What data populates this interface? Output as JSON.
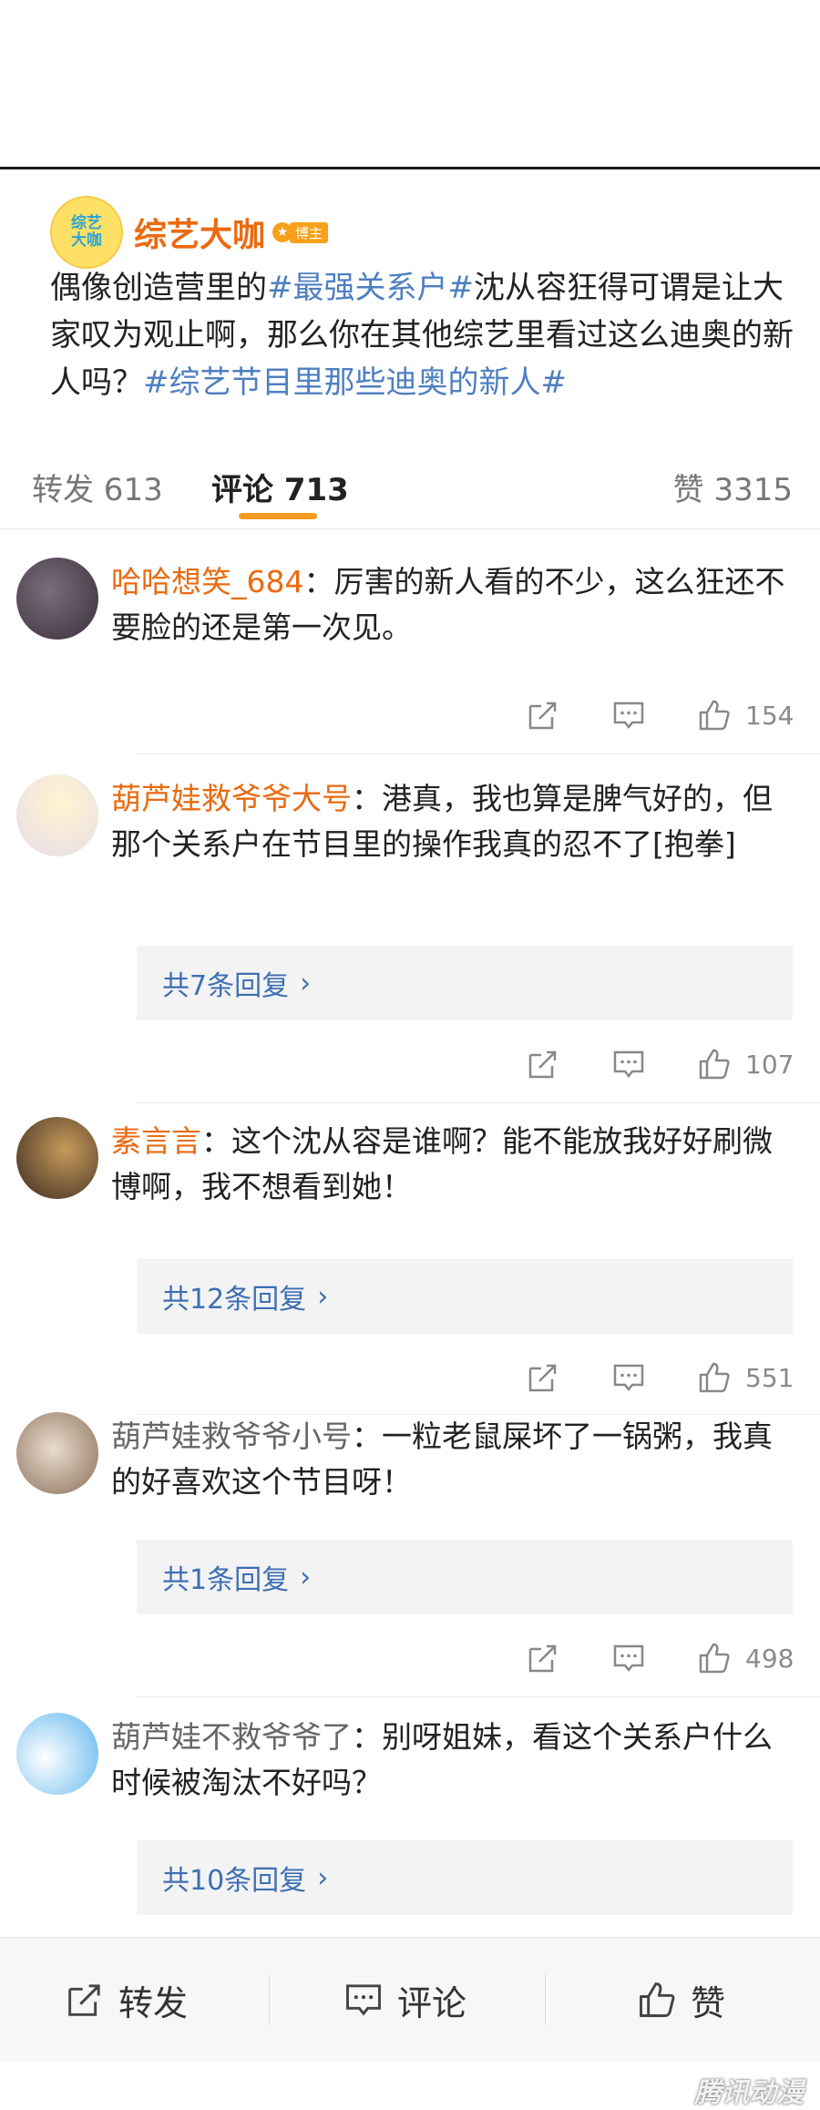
{
  "post": {
    "avatar_text_line1": "综艺",
    "avatar_text_line2": "大咖",
    "author": "综艺大咖",
    "badge_label": "博主",
    "text_part1": "偶像创造营里的",
    "tag1": "#最强关系户#",
    "text_part2": "沈从容狂得可谓是让大家叹为观止啊，那么你在其他综艺里看过这么迪奥的新人吗？",
    "tag2": "#综艺节目里那些迪奥的新人#"
  },
  "tabs": {
    "repost": "转发 613",
    "comment": "评论 713",
    "like": "赞 3315"
  },
  "comments": [
    {
      "user": "哈哈想笑_684",
      "text": "：厉害的新人看的不少，这么狂还不要脸的还是第一次见。",
      "likes": "154"
    },
    {
      "user": "葫芦娃救爷爷大号",
      "text": "：港真，我也算是脾气好的，但那个关系户在节目里的操作我真的忍不了[抱拳]",
      "replies": "共7条回复",
      "likes": "107"
    },
    {
      "user": "素言言",
      "text": "：这个沈从容是谁啊？能不能放我好好刷微博啊，我不想看到她！",
      "replies": "共12条回复",
      "likes": "551"
    },
    {
      "user": "葫芦娃救爷爷小号",
      "text": "：一粒老鼠屎坏了一锅粥，我真的好喜欢这个节目呀！",
      "replies": "共1条回复",
      "likes": "498"
    },
    {
      "user": "葫芦娃不救爷爷了",
      "text": "：别呀姐妹，看这个关系户什么时候被淘汰不好吗？",
      "replies": "共10条回复"
    }
  ],
  "bottom_bar": {
    "repost": "转发",
    "comment": "评论",
    "like": "赞"
  },
  "watermark": "腾讯动漫",
  "colors": {
    "accent_orange": "#ea6a10",
    "tab_underline": "#f59b1f",
    "link_blue": "#3d6fb3"
  }
}
